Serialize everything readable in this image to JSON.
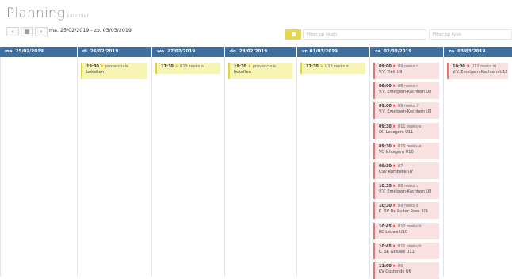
{
  "app": {
    "title": "Planning",
    "subtitle": "kalender"
  },
  "nav": {
    "prev_icon": "‹",
    "calendar_icon": "▦",
    "next_icon": "›",
    "range": "ma. 25/02/2019 - zo. 03/03/2019"
  },
  "filters": {
    "team_placeholder": "Filter op team",
    "type_placeholder": "Filter op type"
  },
  "colors": {
    "header": "#3e6f9f",
    "filter_button": "#e6d84a",
    "yellow_event": "#f7f4b4",
    "red_event": "#fae1e1",
    "red_icon": "#d93b3b"
  },
  "days": [
    {
      "label": "ma. 25/02/2019",
      "events": []
    },
    {
      "label": "di. 26/02/2019",
      "events": [
        {
          "time": "19:30",
          "icon": "trophy-icon",
          "level": "provenciale",
          "team": "bekeften",
          "style": "yellow"
        }
      ]
    },
    {
      "label": "wo. 27/02/2019",
      "events": [
        {
          "time": "17:30",
          "icon": "trophy-icon",
          "level": "U15 reeks o",
          "team": "",
          "style": "yellow"
        }
      ]
    },
    {
      "label": "do. 28/02/2019",
      "events": [
        {
          "time": "19:30",
          "icon": "trophy-icon",
          "level": "provenciale",
          "team": "bekeften",
          "style": "yellow"
        }
      ]
    },
    {
      "label": "vr. 01/03/2019",
      "events": [
        {
          "time": "17:30",
          "icon": "trophy-icon",
          "level": "U15 reeks o",
          "team": "",
          "style": "yellow"
        }
      ]
    },
    {
      "label": "za. 02/03/2019",
      "events": [
        {
          "time": "09:00",
          "icon": "cross-icon",
          "level": "U9 reeks i",
          "team": "V.V. Tielt U9",
          "style": "red"
        },
        {
          "time": "09:00",
          "icon": "cross-icon",
          "level": "U8 reeks i",
          "team": "V.V. Emelgem-Kachtem U8",
          "style": "red"
        },
        {
          "time": "09:00",
          "icon": "cross-icon",
          "level": "U8 reeks ff",
          "team": "V.V. Emelgem-Kachtem U8",
          "style": "red"
        },
        {
          "time": "09:30",
          "icon": "cross-icon",
          "level": "U11 reeks e",
          "team": "Ol. Ledegem U11",
          "style": "red"
        },
        {
          "time": "09:30",
          "icon": "cross-icon",
          "level": "U10 reeks e",
          "team": "VC Ichtegem U10",
          "style": "red"
        },
        {
          "time": "09:30",
          "icon": "cross-icon",
          "level": "U7",
          "team": "KSV Rumbeke U7",
          "style": "red"
        },
        {
          "time": "10:30",
          "icon": "cross-icon",
          "level": "U8 reeks u",
          "team": "V.V. Emelgem-Kachtem U8",
          "style": "red"
        },
        {
          "time": "10:30",
          "icon": "cross-icon",
          "level": "U9 reeks b",
          "team": "K. SV De Ruiter Roes. U9",
          "style": "red"
        },
        {
          "time": "10:45",
          "icon": "cross-icon",
          "level": "U10 reeks h",
          "team": "RC Leuwe U10",
          "style": "red"
        },
        {
          "time": "10:45",
          "icon": "cross-icon",
          "level": "U11 reeks h",
          "team": "K. SK Geluwe U11",
          "style": "red"
        },
        {
          "time": "11:00",
          "icon": "cross-icon",
          "level": "U6",
          "team": "KV Oostende U6",
          "style": "red"
        }
      ]
    },
    {
      "label": "zo. 03/03/2019",
      "events": [
        {
          "time": "10:00",
          "icon": "cross-icon",
          "level": "U12 reeks m",
          "team": "V.V. Emelgem-Kachtem U12",
          "style": "red"
        }
      ]
    }
  ]
}
